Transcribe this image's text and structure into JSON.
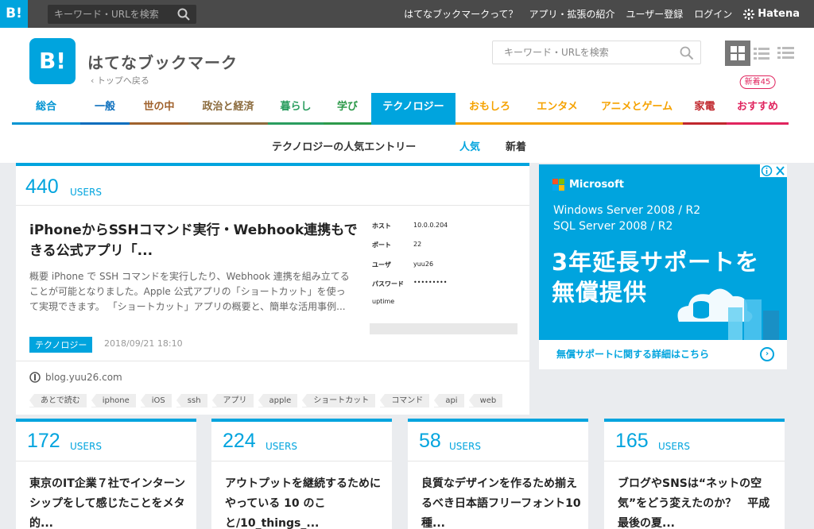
{
  "global_bar": {
    "logo": "B!",
    "search_placeholder": "キーワード・URLを検索",
    "links": [
      "はてなブックマークって？",
      "アプリ・拡張の紹介",
      "ユーザー登録",
      "ログイン"
    ],
    "hatena": "Hatena"
  },
  "header": {
    "logo": "B!",
    "title": "はてなブックマーク",
    "back_link": "‹ トップへ戻る",
    "search_placeholder": "キーワード・URLを検索"
  },
  "nav": {
    "items": [
      {
        "label": "総合",
        "color": "#0094d2"
      },
      {
        "label": "一般",
        "color": "#0a6ebd"
      },
      {
        "label": "世の中",
        "color": "#a0622d"
      },
      {
        "label": "政治と経済",
        "color": "#8b6b3d"
      },
      {
        "label": "暮らし",
        "color": "#2a9d5f"
      },
      {
        "label": "学び",
        "color": "#2d9a4a"
      },
      {
        "label": "テクノロジー",
        "color": "#00a4de"
      },
      {
        "label": "おもしろ",
        "color": "#f5a200"
      },
      {
        "label": "エンタメ",
        "color": "#f5a200"
      },
      {
        "label": "アニメとゲーム",
        "color": "#f5a200"
      },
      {
        "label": "家電",
        "color": "#c0272d"
      },
      {
        "label": "おすすめ",
        "color": "#e0245e"
      }
    ],
    "badge": "新着45"
  },
  "subnav": {
    "title": "テクノロジーの人気エントリー",
    "popular": "人気",
    "new": "新着"
  },
  "top_entry": {
    "users": "440",
    "users_label": "USERS",
    "title": "iPhoneからSSHコマンド実行・Webhook連携もできる公式アプリ「...",
    "description": "概要 iPhone で SSH コマンドを実行したり、Webhook 連携を組み立てることが可能となりました。Apple 公式アプリの「ショートカット」を使って実現できます。 「ショートカット」アプリの概要と、簡単な活用事例...",
    "category": "テクノロジー",
    "date": "2018/09/21 18:10",
    "domain": "blog.yuu26.com",
    "thumbnail": {
      "rows": [
        {
          "label": "ホスト",
          "value": "10.0.0.204"
        },
        {
          "label": "ポート",
          "value": "22"
        },
        {
          "label": "ユーザ",
          "value": "yuu26"
        },
        {
          "label": "パスワード",
          "value": "•••••••••"
        },
        {
          "label": "uptime",
          "value": ""
        }
      ]
    },
    "tags": [
      "あとで読む",
      "iphone",
      "iOS",
      "ssh",
      "アプリ",
      "apple",
      "ショートカット",
      "コマンド",
      "api",
      "web"
    ]
  },
  "ad": {
    "brand": "Microsoft",
    "line1": "Windows Server 2008 / R2",
    "line2": "SQL Server 2008 / R2",
    "big1": "3年延長サポートを",
    "big2": "無償提供",
    "footer": "無償サポートに関する詳細はこちら",
    "arrow": "›"
  },
  "entries": [
    {
      "users": "172",
      "users_label": "USERS",
      "title": "東京のIT企業７社でインターンシップをして感じたことをメタ的..."
    },
    {
      "users": "224",
      "users_label": "USERS",
      "title": "アウトプットを継続するためにやっている 10 のこと/10_things_..."
    },
    {
      "users": "58",
      "users_label": "USERS",
      "title": "良質なデザインを作るため揃えるべき日本語フリーフォント10種..."
    },
    {
      "users": "165",
      "users_label": "USERS",
      "title": "ブログやSNSは“ネットの空気”をどう変えたのか？　平成最後の夏..."
    }
  ]
}
